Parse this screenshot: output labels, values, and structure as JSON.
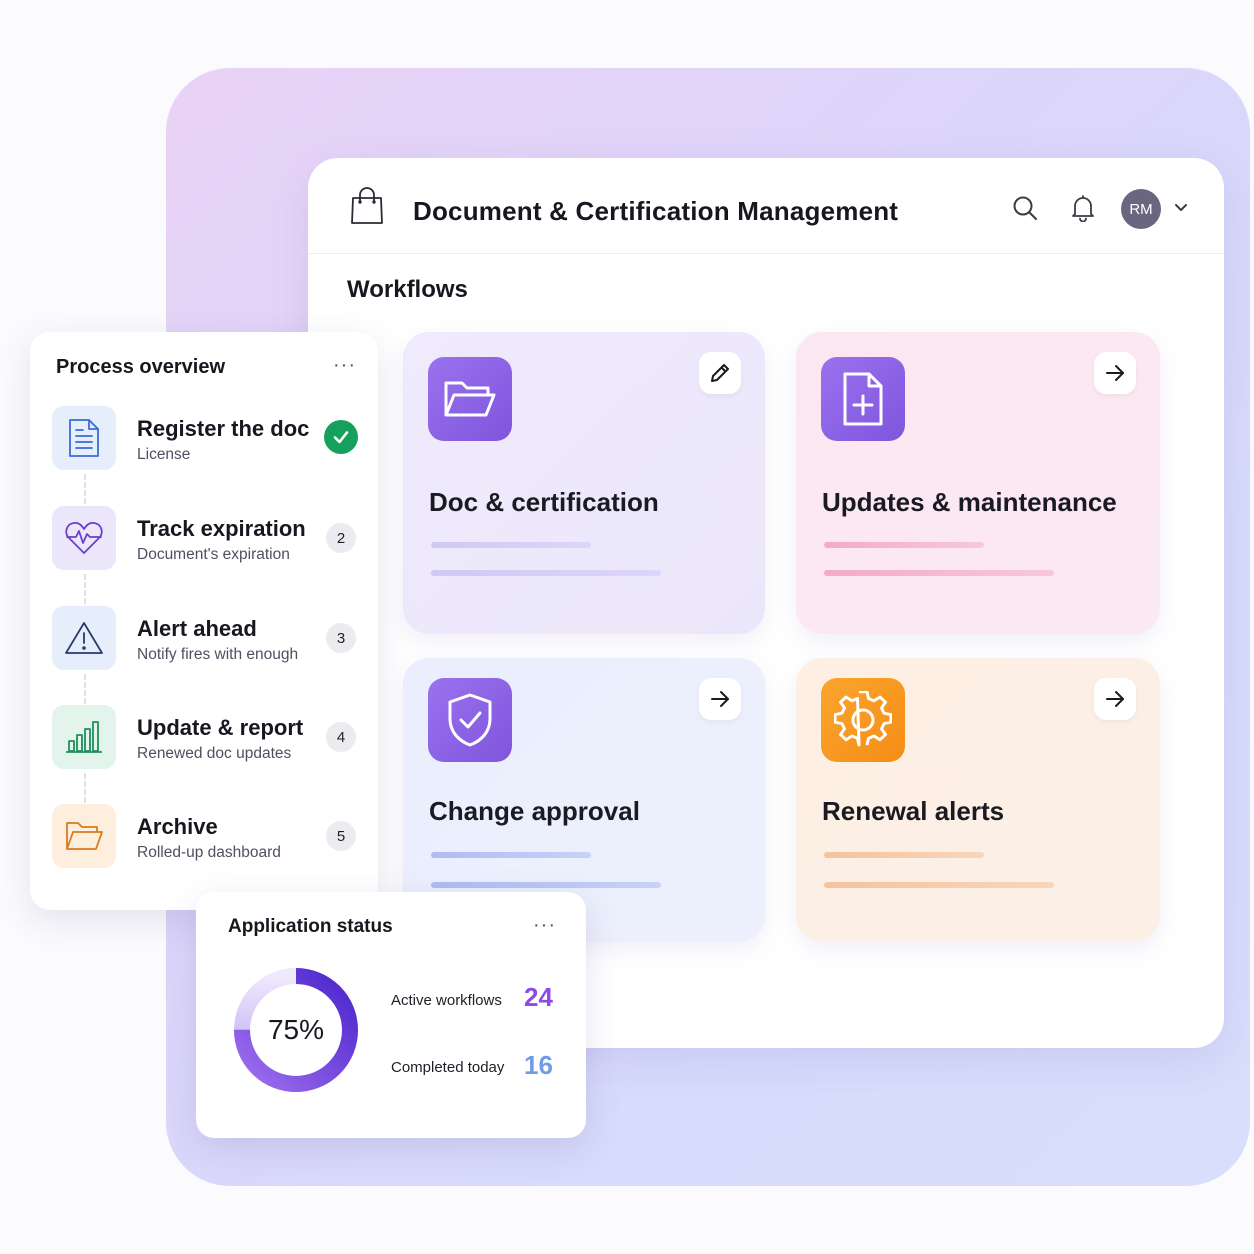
{
  "header": {
    "app_title": "Document & Certification Management",
    "avatar_initials": "RM",
    "icons": [
      "shopping-bag-icon",
      "search-icon",
      "bell-icon",
      "chevron-down-icon"
    ]
  },
  "workflows": {
    "section_title": "Workflows",
    "cards": [
      {
        "title": "Doc & certification",
        "icon": "folder-open-icon",
        "action_icon": "pencil-icon",
        "accent": "#8d63e6"
      },
      {
        "title": "Updates & maintenance",
        "icon": "file-plus-icon",
        "action_icon": "arrow-right-icon",
        "accent": "#8d63e6"
      },
      {
        "title": "Change approval",
        "icon": "shield-check-icon",
        "action_icon": "arrow-right-icon",
        "accent": "#8d63e6"
      },
      {
        "title": "Renewal alerts",
        "icon": "gear-icon",
        "action_icon": "arrow-right-icon",
        "accent": "#f7991f"
      }
    ]
  },
  "process_overview": {
    "title": "Process overview",
    "more_label": "···",
    "steps": [
      {
        "title": "Register the doc",
        "subtitle": "License",
        "status": "done",
        "icon": "document-icon"
      },
      {
        "title": "Track expiration",
        "subtitle": "Document's expiration",
        "badge": "2",
        "icon": "heartbeat-icon"
      },
      {
        "title": "Alert ahead",
        "subtitle": "Notify fires with enough",
        "badge": "3",
        "icon": "warning-icon"
      },
      {
        "title": "Update & report",
        "subtitle": "Renewed doc updates",
        "badge": "4",
        "icon": "bar-chart-icon"
      },
      {
        "title": "Archive",
        "subtitle": "Rolled-up dashboard",
        "badge": "5",
        "icon": "folder-icon"
      }
    ]
  },
  "application_status": {
    "title": "Application status",
    "more_label": "···",
    "progress_label": "75%",
    "progress_fraction": 0.75,
    "stats": [
      {
        "label": "Active workflows",
        "value": "24"
      },
      {
        "label": "Completed today",
        "value": "16"
      }
    ],
    "colors": {
      "accent": "#5b2fd8",
      "track": "#e6ddfb",
      "active_value": "#8b4be8",
      "completed_value": "#6f9be8"
    }
  }
}
